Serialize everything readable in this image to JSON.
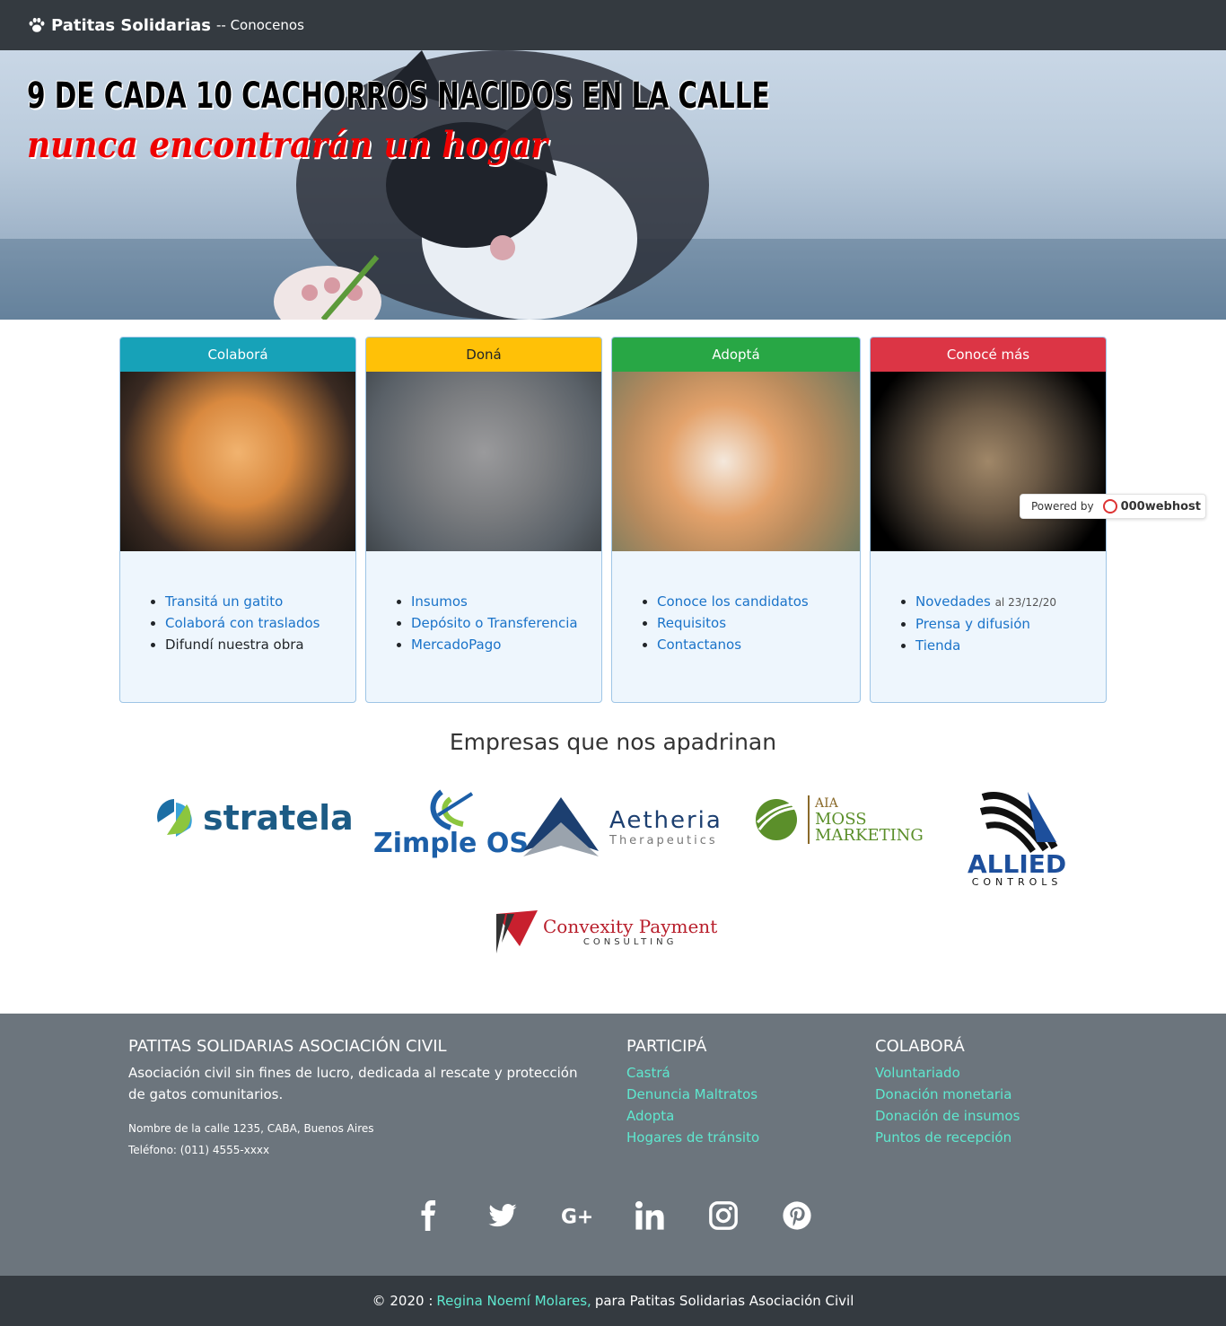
{
  "navbar": {
    "brand": "Patitas Solidarias",
    "separator": "-- Conocenos",
    "icon": "paw-icon"
  },
  "hero": {
    "headline": "9 DE CADA 10 CACHORROS NACIDOS EN LA CALLE",
    "subheadline": "nunca encontrarán un hogar"
  },
  "cards": [
    {
      "title": "Colaborá",
      "color": "#17a2b8",
      "items": [
        {
          "label": "Transitá un gatito",
          "link": true
        },
        {
          "label": "Colaborá con traslados",
          "link": true
        },
        {
          "label": "Difundí nuestra obra",
          "link": false
        }
      ]
    },
    {
      "title": "Doná",
      "color": "#ffc107",
      "items": [
        {
          "label": "Insumos",
          "link": true
        },
        {
          "label": "Depósito o Transferencia",
          "link": true
        },
        {
          "label": "MercadoPago",
          "link": true
        }
      ]
    },
    {
      "title": "Adoptá",
      "color": "#28a745",
      "items": [
        {
          "label": "Conoce los candidatos",
          "link": true
        },
        {
          "label": "Requisitos",
          "link": true
        },
        {
          "label": "Contactanos",
          "link": true
        }
      ]
    },
    {
      "title": "Conocé más",
      "color": "#dc3545",
      "items": [
        {
          "label": "Novedades",
          "link": true,
          "note": "al 23/12/20"
        },
        {
          "label": "Prensa y difusión",
          "link": true
        },
        {
          "label": "Tienda",
          "link": true
        }
      ]
    }
  ],
  "powered": {
    "label": "Powered by",
    "host": "000webhost"
  },
  "sponsors": {
    "title": "Empresas que nos apadrinan",
    "logos": {
      "stratela": "stratela",
      "zimple": "Zimple OS",
      "aetheria": "Aetheria",
      "aetheria_sub": "Therapeutics",
      "aia_top": "AIA",
      "aia_mid": "MOSS",
      "aia_bot": "MARKETING",
      "allied": "ALLIED",
      "allied_sub": "CONTROLS",
      "convexity": "Convexity Payment",
      "convexity_sub": "CONSULTING"
    }
  },
  "footer": {
    "org_title": "PATITAS SOLIDARIAS ASOCIACIÓN CIVIL",
    "org_desc": "Asociación civil sin fines de lucro, dedicada al rescate y protección de gatos comunitarios.",
    "address": "Nombre de la calle 1235, CABA, Buenos Aires",
    "phone": "Teléfono: (011) 4555-xxxx",
    "col2_title": "PARTICIPÁ",
    "col2_links": [
      "Castrá",
      "Denuncia Maltratos",
      "Adopta",
      "Hogares de tránsito"
    ],
    "col3_title": "COLABORÁ",
    "col3_links": [
      "Voluntariado",
      "Donación monetaria",
      "Donación de insumos",
      "Puntos de recepción"
    ],
    "social": [
      "facebook-icon",
      "twitter-icon",
      "google-plus-icon",
      "linkedin-icon",
      "instagram-icon",
      "pinterest-icon"
    ]
  },
  "bottom": {
    "prefix": "© 2020 :",
    "author": "Regina Noemí Molares,",
    "suffix": "para Patitas Solidarias Asociación Civil"
  }
}
